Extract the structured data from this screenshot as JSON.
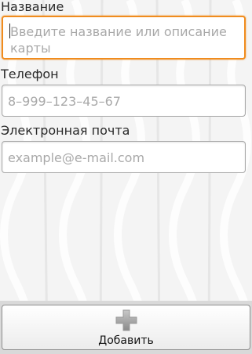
{
  "form": {
    "name": {
      "label": "Название",
      "placeholder": "Введите название или описание карты"
    },
    "phone": {
      "label": "Телефон",
      "placeholder": "8–999–123–45–67"
    },
    "email": {
      "label": "Электронная почта",
      "placeholder": "example@e-mail.com"
    }
  },
  "actions": {
    "add_label": "Добавить",
    "add_icon": "plus-icon"
  },
  "colors": {
    "focus_border": "#f08c1e",
    "placeholder_text": "#a9a9a9"
  }
}
